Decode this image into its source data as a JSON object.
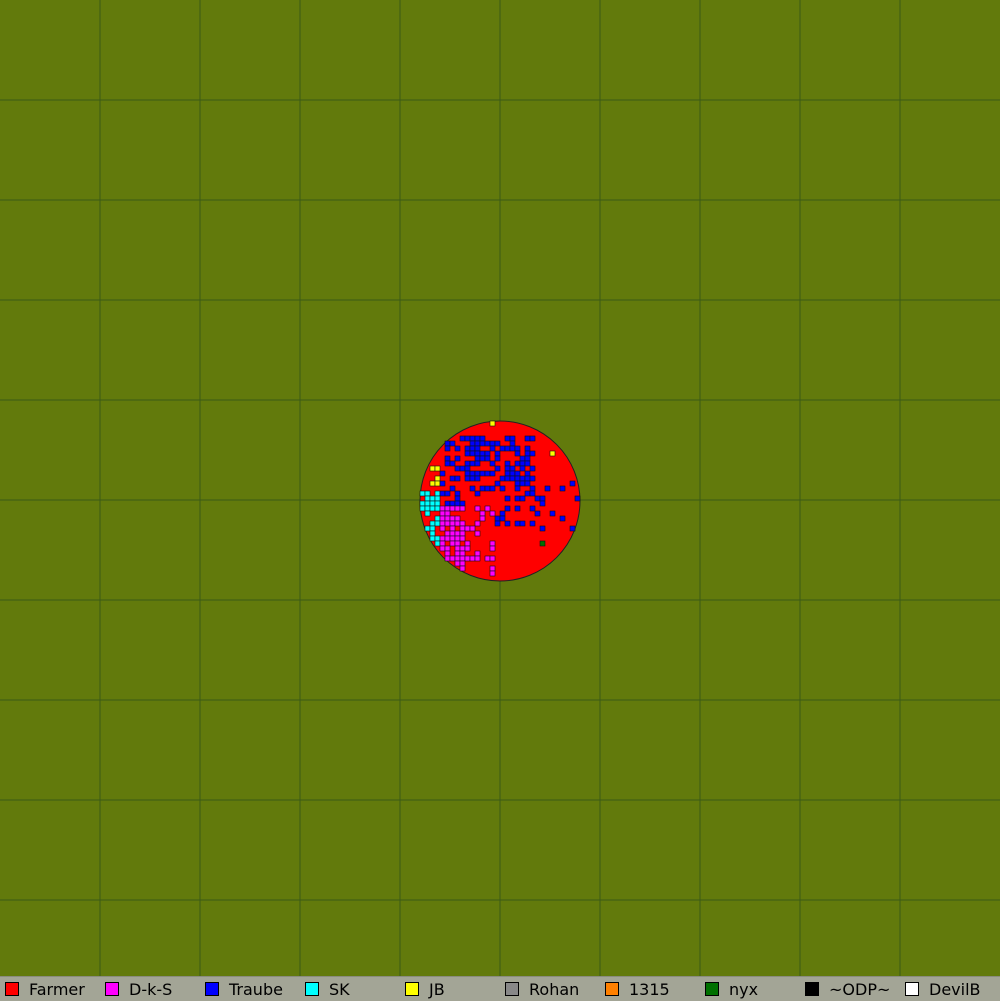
{
  "map": {
    "background": "#627a0c",
    "grid_color": "#3a5a16",
    "grid_cells": 10,
    "owner_colors": {
      "Farmer": "#ff0000",
      "D-k-S": "#ff00ff",
      "Traube": "#0000ff",
      "SK": "#00ffff",
      "JB": "#ffff00",
      "Rohan": "#888888",
      "1315": "#ff8000",
      "nyx": "#007000",
      "~ODP~": "#000000",
      "DevilB": "#ffffff"
    }
  },
  "legend": {
    "items": [
      {
        "label": "Farmer",
        "color": "#ff0000"
      },
      {
        "label": "D-k-S",
        "color": "#ff00ff"
      },
      {
        "label": "Traube",
        "color": "#0000ff"
      },
      {
        "label": "SK",
        "color": "#00ffff"
      },
      {
        "label": "JB",
        "color": "#ffff00"
      },
      {
        "label": "Rohan",
        "color": "#888888"
      },
      {
        "label": "1315",
        "color": "#ff8000"
      },
      {
        "label": "nyx",
        "color": "#007000"
      },
      {
        "label": "~ODP~",
        "color": "#000000"
      },
      {
        "label": "DevilB",
        "color": "#ffffff"
      }
    ]
  }
}
